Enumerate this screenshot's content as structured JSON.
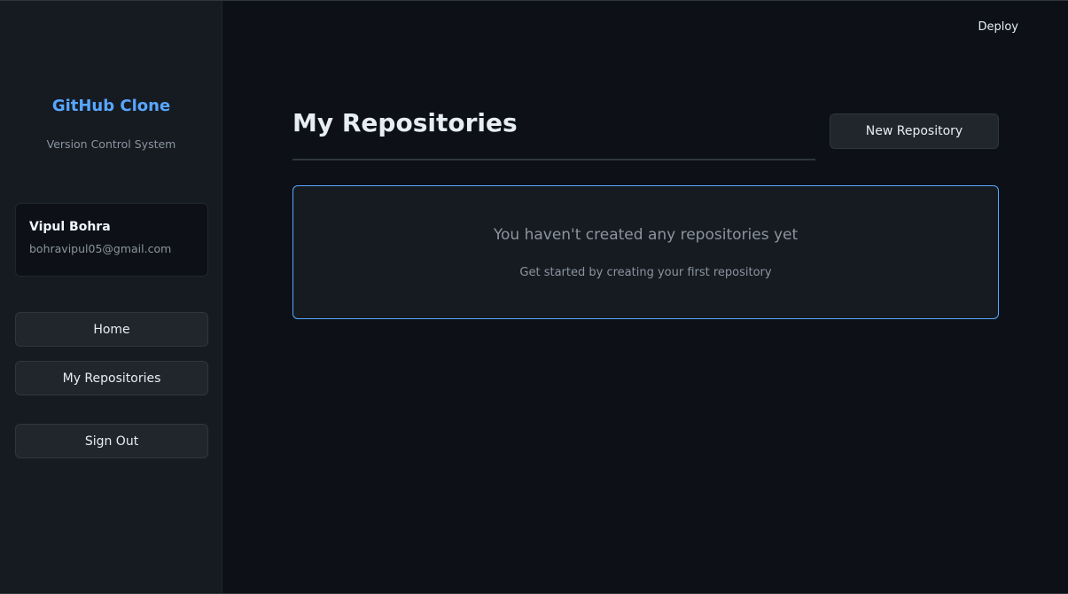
{
  "sidebar": {
    "brand_title": "GitHub Clone",
    "brand_subtitle": "Version Control System",
    "user": {
      "name": "Vipul Bohra",
      "email": "bohravipul05@gmail.com"
    },
    "nav": {
      "home": "Home",
      "my_repositories": "My Repositories",
      "sign_out": "Sign Out"
    }
  },
  "header": {
    "deploy_label": "Deploy"
  },
  "main": {
    "title": "My Repositories",
    "new_repo_label": "New Repository",
    "empty_state": {
      "title": "You haven't created any repositories yet",
      "subtitle": "Get started by creating your first repository"
    }
  },
  "colors": {
    "background": "#0d1117",
    "sidebar": "#161b22",
    "accent": "#58a6ff",
    "button": "#21262d",
    "muted_text": "#8b949e"
  }
}
